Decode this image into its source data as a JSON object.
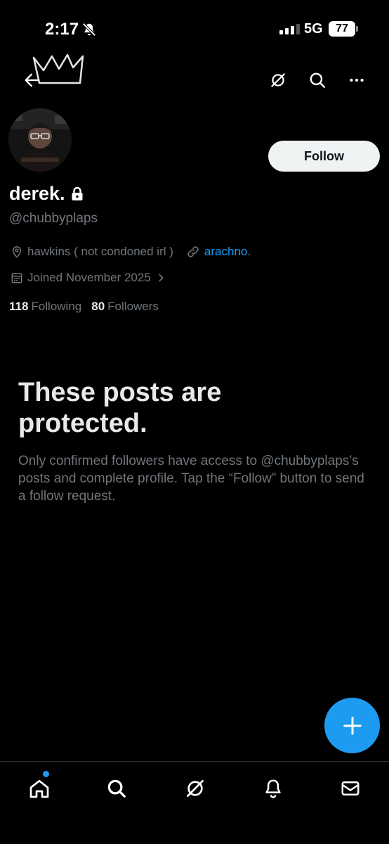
{
  "status_bar": {
    "time": "2:17",
    "network": "5G",
    "battery": "77",
    "icons": [
      "bell-slash-icon",
      "signal-icon",
      "battery-icon"
    ]
  },
  "top_nav": {
    "icons": [
      "back-arrow-icon",
      "crown-icon",
      "grok-icon",
      "search-icon",
      "more-icon"
    ]
  },
  "profile": {
    "display_name": "derek.",
    "handle": "@chubbyplaps",
    "location": "hawkins ( not condoned irl )",
    "website": "arachno.",
    "joined": "Joined November 2025",
    "following_count": "118",
    "following_label": "Following",
    "followers_count": "80",
    "followers_label": "Followers",
    "follow_button": "Follow",
    "icons": [
      "lock-icon",
      "location-icon",
      "link-icon",
      "calendar-icon",
      "chevron-right-icon"
    ]
  },
  "protected_notice": {
    "title": "These posts are protected.",
    "body": "Only confirmed followers have access to @chubbyplaps’s posts and complete profile. Tap the “Follow” button to send a follow request."
  },
  "fab": {
    "icon": "plus-icon"
  },
  "tab_bar": {
    "items": [
      {
        "icon": "home-icon",
        "has_notification_dot": true
      },
      {
        "icon": "search-icon"
      },
      {
        "icon": "grok-icon"
      },
      {
        "icon": "bell-icon"
      },
      {
        "icon": "mail-icon"
      }
    ]
  },
  "colors": {
    "background": "#000000",
    "accent": "#1d9bf0",
    "text_primary": "#e7e9ea",
    "text_secondary": "#71767b",
    "follow_button_bg": "#eff3f4"
  }
}
